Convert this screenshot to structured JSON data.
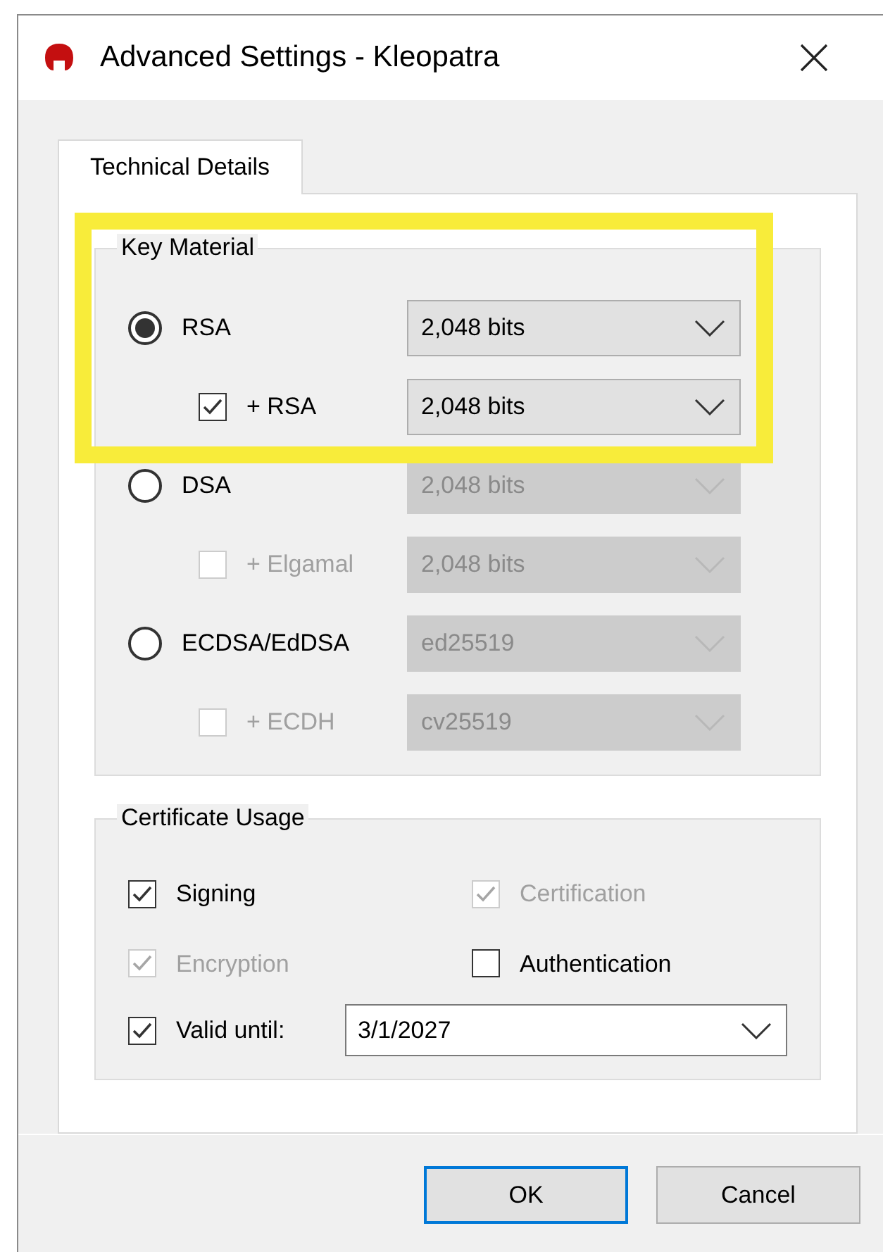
{
  "window": {
    "title": "Advanced Settings - Kleopatra"
  },
  "tabs": [
    {
      "label": "Technical Details",
      "selected": true
    }
  ],
  "key_material": {
    "title": "Key Material",
    "rows": [
      {
        "kind": "radio",
        "label": "RSA",
        "selected": true,
        "combo": {
          "value": "2,048 bits",
          "disabled": false
        }
      },
      {
        "kind": "checkbox",
        "label": "+ RSA",
        "checked": true,
        "disabled": false,
        "combo": {
          "value": "2,048 bits",
          "disabled": false
        }
      },
      {
        "kind": "radio",
        "label": "DSA",
        "selected": false,
        "combo": {
          "value": "2,048 bits",
          "disabled": true
        }
      },
      {
        "kind": "checkbox",
        "label": "+ Elgamal",
        "checked": false,
        "disabled": true,
        "combo": {
          "value": "2,048 bits",
          "disabled": true
        }
      },
      {
        "kind": "radio",
        "label": "ECDSA/EdDSA",
        "selected": false,
        "combo": {
          "value": "ed25519",
          "disabled": true
        }
      },
      {
        "kind": "checkbox",
        "label": "+ ECDH",
        "checked": false,
        "disabled": true,
        "combo": {
          "value": "cv25519",
          "disabled": true
        }
      }
    ]
  },
  "certificate_usage": {
    "title": "Certificate Usage",
    "options": [
      {
        "label": "Signing",
        "checked": true,
        "disabled": false
      },
      {
        "label": "Certification",
        "checked": true,
        "disabled": true
      },
      {
        "label": "Encryption",
        "checked": true,
        "disabled": true
      },
      {
        "label": "Authentication",
        "checked": false,
        "disabled": false
      }
    ],
    "valid_until": {
      "label": "Valid until:",
      "checked": true,
      "value": "3/1/2027"
    }
  },
  "buttons": [
    {
      "label": "OK",
      "default": true
    },
    {
      "label": "Cancel",
      "default": false
    }
  ]
}
